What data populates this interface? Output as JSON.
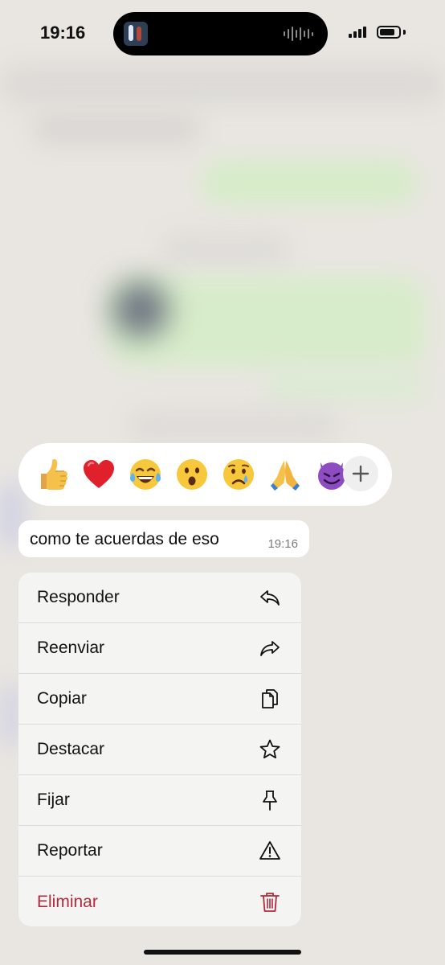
{
  "status_bar": {
    "time": "19:16",
    "signal_bars": 4,
    "battery_level": 0.8
  },
  "reactions": {
    "items": [
      {
        "name": "thumbs-up",
        "glyph": "👍"
      },
      {
        "name": "red-heart",
        "glyph": "❤️"
      },
      {
        "name": "tears-of-joy",
        "glyph": "😂"
      },
      {
        "name": "astonished",
        "glyph": "😮"
      },
      {
        "name": "crying",
        "glyph": "😢"
      },
      {
        "name": "folded-hands",
        "glyph": "🙏"
      },
      {
        "name": "smiling-devil",
        "glyph": "😈"
      }
    ],
    "more_icon": "plus-icon"
  },
  "message": {
    "text": "como te acuerdas de eso",
    "time": "19:16"
  },
  "menu": {
    "items": [
      {
        "label": "Responder",
        "icon": "reply-icon"
      },
      {
        "label": "Reenviar",
        "icon": "forward-icon"
      },
      {
        "label": "Copiar",
        "icon": "copy-icon"
      },
      {
        "label": "Destacar",
        "icon": "star-icon"
      },
      {
        "label": "Fijar",
        "icon": "pin-icon"
      },
      {
        "label": "Reportar",
        "icon": "warning-icon"
      },
      {
        "label": "Eliminar",
        "icon": "trash-icon",
        "color": "#b22a3b"
      }
    ]
  },
  "colors": {
    "danger": "#b22a3b",
    "background": "#e9e6e1",
    "bubble": "#ffffff"
  }
}
